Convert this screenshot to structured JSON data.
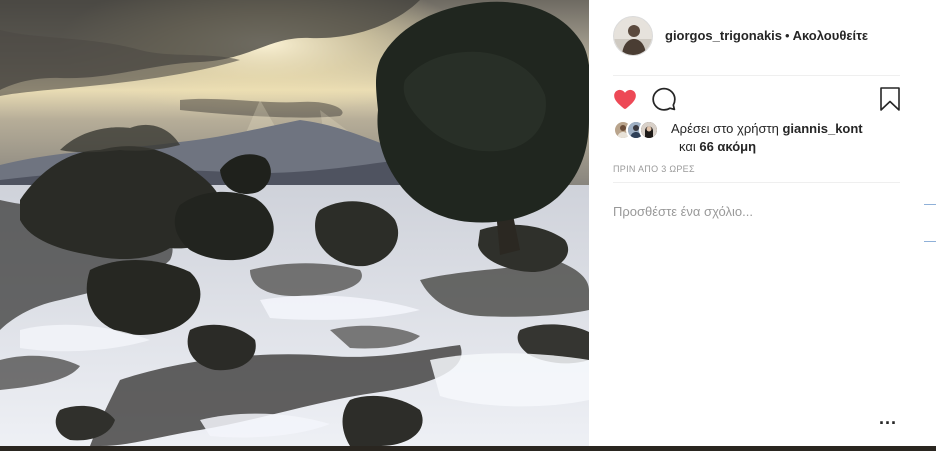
{
  "post": {
    "username": "giorgos_trigonakis",
    "separator": "•",
    "follow_status": "Ακολουθείτε",
    "likes": {
      "prefix": "Αρέσει στο χρήστη ",
      "liker": "giannis_kont",
      "and": "και ",
      "others": "66 ακόμη"
    },
    "timestamp": "ΠΡΙΝ ΑΠΟ 3 ΩΡΕΣ",
    "comment_placeholder": "Προσθέστε ένα σχόλιο...",
    "more_label": "...",
    "liked": true
  },
  "icons": {
    "like": "heart-icon",
    "comment": "comment-icon",
    "save": "bookmark-icon",
    "more": "more-options-icon"
  },
  "colors": {
    "heart": "#ed4956",
    "text": "#262626",
    "muted": "#999999",
    "divider": "#efefef"
  }
}
